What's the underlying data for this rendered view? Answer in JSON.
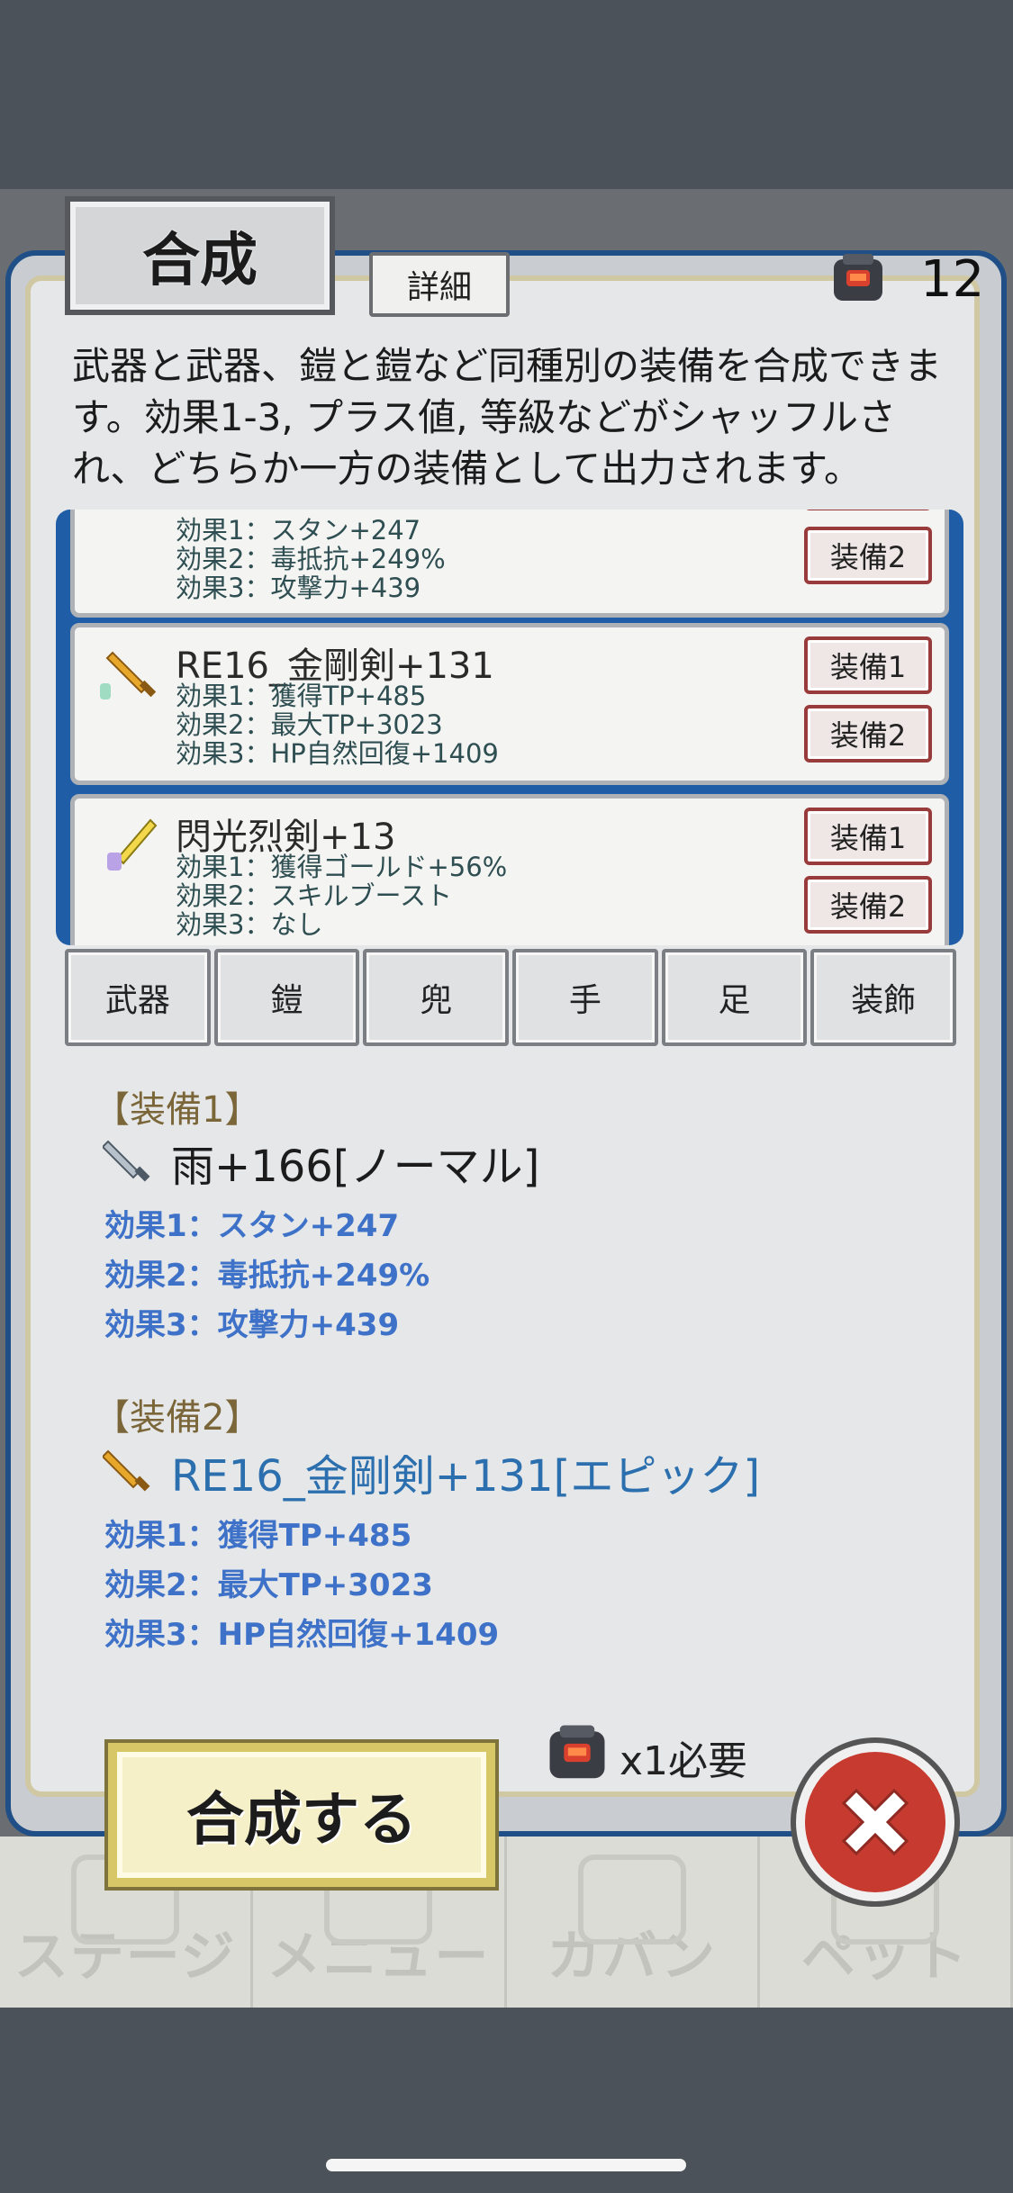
{
  "title": "合成",
  "detail_label": "詳細",
  "stone_count": "12",
  "description": "武器と武器、鎧と鎧など同種別の装備を合成できます。効果1-3, プラス値, 等級などがシャッフルされ、どちらか一方の装備として出力されます。",
  "list": {
    "items": [
      {
        "name": "",
        "effects": [
          "効果1：スタン+247",
          "効果2：毒抵抗+249%",
          "効果3：攻撃力+439"
        ],
        "btn1": "",
        "btn2": "装備2"
      },
      {
        "name": "RE16_金剛剣+131",
        "effects": [
          "効果1：獲得TP+485",
          "効果2：最大TP+3023",
          "効果3：HP自然回復+1409"
        ],
        "btn1": "装備1",
        "btn2": "装備2"
      },
      {
        "name": "閃光烈剣+13",
        "effects": [
          "効果1：獲得ゴールド+56%",
          "効果2：スキルブースト",
          "効果3：なし"
        ],
        "btn1": "装備1",
        "btn2": "装備2"
      }
    ]
  },
  "tabs": [
    "武器",
    "鎧",
    "兜",
    "手",
    "足",
    "装飾"
  ],
  "equip1": {
    "header": "【装備1】",
    "name": "雨+166[ノーマル]",
    "name_color": "#1c1c1c",
    "effects": [
      "効果1：スタン+247",
      "効果2：毒抵抗+249%",
      "効果3：攻撃力+439"
    ]
  },
  "equip2": {
    "header": "【装備2】",
    "name": "RE16_金剛剣+131[エピック]",
    "name_color": "#2b6fae",
    "effects": [
      "効果1：獲得TP+485",
      "効果2：最大TP+3023",
      "効果3：HP自然回復+1409"
    ]
  },
  "requirement": "x1必要",
  "synthesize_label": "合成する",
  "nav": [
    "ステージ",
    "メニュー",
    "カバン",
    "ペット"
  ],
  "colors": {
    "accent_blue": "#1f5ea6",
    "effect_blue": "#3e71c8",
    "close_red": "#c63a30",
    "gold": "#d8c766"
  },
  "icons": {
    "stone": "furnace-stone-icon",
    "sword_gold": "gold-sword-icon",
    "sword_silver": "silver-sword-icon",
    "close": "close-x-icon"
  }
}
